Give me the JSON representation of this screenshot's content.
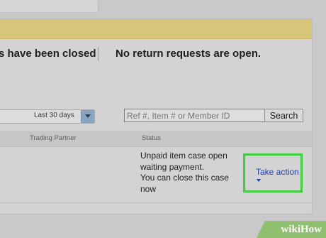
{
  "summary": {
    "closed_text": "s have been closed",
    "open_text": "No return requests are open."
  },
  "filters": {
    "period_value": "Last 30 days",
    "search_placeholder": "Ref #, Item # or Member ID",
    "search_button": "Search"
  },
  "table": {
    "columns": [
      "Trading Partner",
      "Status"
    ],
    "rows": [
      {
        "status_lines": [
          "Unpaid item case open",
          "waiting payment.",
          "You can close this case",
          "now"
        ],
        "action": "Take action"
      }
    ]
  },
  "watermark": {
    "text": "wikiHow"
  },
  "colors": {
    "highlight": "#3fcc3f",
    "link": "#1f3fa8",
    "banner": "#d8c77a"
  },
  "icons": {
    "dropdown": "caret-down-icon",
    "action_menu": "caret-down-icon"
  }
}
